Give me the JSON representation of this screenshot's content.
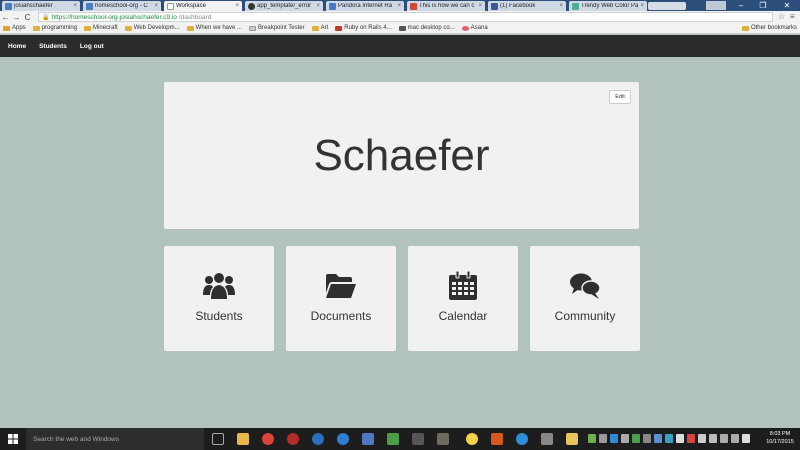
{
  "browser": {
    "tabs": [
      {
        "title": "josiahschaefer",
        "color": "#4a7fc1",
        "close": "×"
      },
      {
        "title": "homeschool-org - C",
        "color": "#4a7fc1",
        "close": "×"
      },
      {
        "title": "Workspace",
        "color": "#ffffff",
        "close": "×",
        "active": true
      },
      {
        "title": "app_template/_error",
        "color": "#333333",
        "close": "×"
      },
      {
        "title": "Pandora Internet Ra",
        "color": "#4a78c8",
        "close": "×"
      },
      {
        "title": "This is how we can c",
        "color": "#d44638",
        "close": "×"
      },
      {
        "title": "(1) Facebook",
        "color": "#3b5998",
        "close": "×"
      },
      {
        "title": "Trendy Web Color Pa",
        "color": "#4caf93",
        "close": "×"
      }
    ],
    "window_controls": {
      "minimize": "–",
      "maximize": "❐",
      "close": "✕"
    },
    "nav": {
      "back": "←",
      "forward": "→",
      "reload": "C"
    },
    "address": {
      "lock": "🔒",
      "host": "https://homeschool-org-josiahschaefer.c9.io",
      "path": "/dashboard"
    },
    "star": "☆",
    "menu": "≡",
    "bookmarks": [
      {
        "label": "Apps",
        "color": "#e0a030"
      },
      {
        "label": "programming",
        "color": "#e0b040"
      },
      {
        "label": "Minecraft",
        "color": "#e0b040"
      },
      {
        "label": "Web Developm...",
        "color": "#e0b040"
      },
      {
        "label": "When we have ...",
        "color": "#e0b040"
      },
      {
        "label": "Breakpoint Tester",
        "color": "#cccccc"
      },
      {
        "label": "Art",
        "color": "#e0b040"
      },
      {
        "label": "Ruby on Rails 4...",
        "color": "#c0392b"
      },
      {
        "label": "mac desktop co...",
        "color": "#555555"
      },
      {
        "label": "Asana",
        "color": "#e06070"
      }
    ],
    "other_bookmarks": "Other bookmarks"
  },
  "app": {
    "nav": [
      {
        "label": "Home"
      },
      {
        "label": "Students"
      },
      {
        "label": "Log out"
      }
    ],
    "hero": {
      "title": "Schaefer",
      "edit_label": "Edit"
    },
    "cards": [
      {
        "label": "Students",
        "icon": "users-icon"
      },
      {
        "label": "Documents",
        "icon": "folder-open-icon"
      },
      {
        "label": "Calendar",
        "icon": "calendar-icon"
      },
      {
        "label": "Community",
        "icon": "comments-icon"
      }
    ],
    "colors": {
      "background": "#b2c2bd",
      "navbar": "#2b2b2b",
      "panel": "#f1f1f1",
      "text": "#333333"
    }
  },
  "taskbar": {
    "search_placeholder": "Search the web and Windows",
    "clock_time": "8:03 PM",
    "clock_date": "10/17/2015"
  }
}
